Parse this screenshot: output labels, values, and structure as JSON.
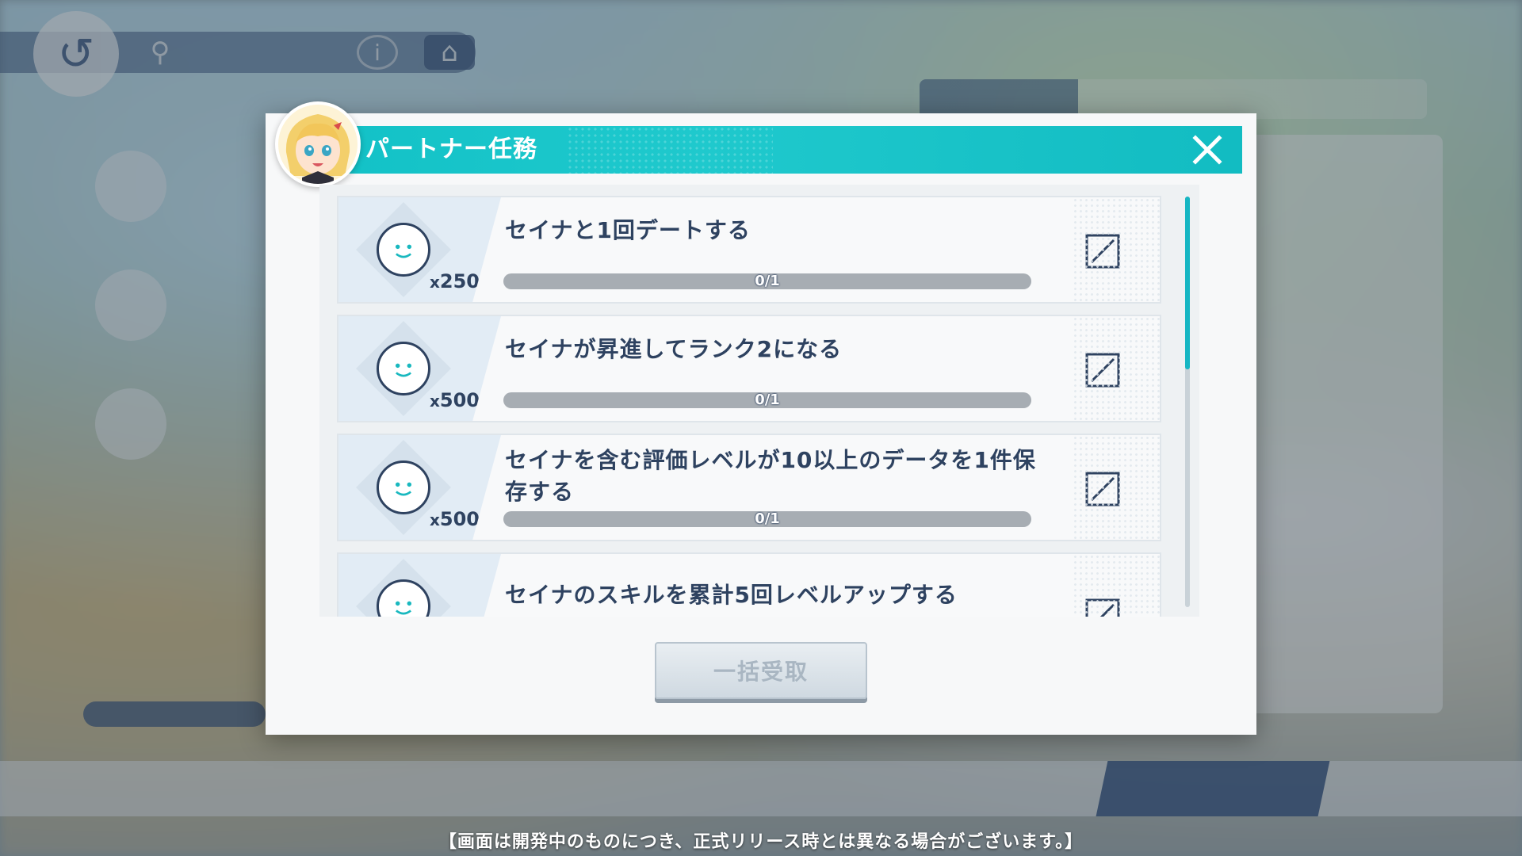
{
  "modal": {
    "title": "パートナー任務",
    "claim_all_label": "一括受取"
  },
  "missions": [
    {
      "text": "セイナと1回デートする",
      "reward_prefix": "x",
      "reward_amount": "250",
      "progress_text": "0/1",
      "progress_fraction": 0
    },
    {
      "text": "セイナが昇進してランク2になる",
      "reward_prefix": "x",
      "reward_amount": "500",
      "progress_text": "0/1",
      "progress_fraction": 0
    },
    {
      "text": "セイナを含む評価レベルが10以上のデータを1件保存する",
      "reward_prefix": "x",
      "reward_amount": "500",
      "progress_text": "0/1",
      "progress_fraction": 0
    },
    {
      "text": "セイナのスキルを累計5回レベルアップする",
      "reward_prefix": "",
      "reward_amount": "",
      "progress_text": "",
      "progress_fraction": 0
    }
  ],
  "footer_notice": "【画面は開発中のものにつき、正式リリース時とは異なる場合がございます。】",
  "icons": {
    "close": "close-icon",
    "reward": "smiley-token-icon",
    "status": "not-complete-icon",
    "avatar": "character-portrait"
  },
  "colors": {
    "header": "#13c2c7",
    "text": "#2e4260",
    "progress_track": "#a7adb3",
    "accent": "#16b6c3",
    "button_disabled_text": "#a9b6c2"
  }
}
